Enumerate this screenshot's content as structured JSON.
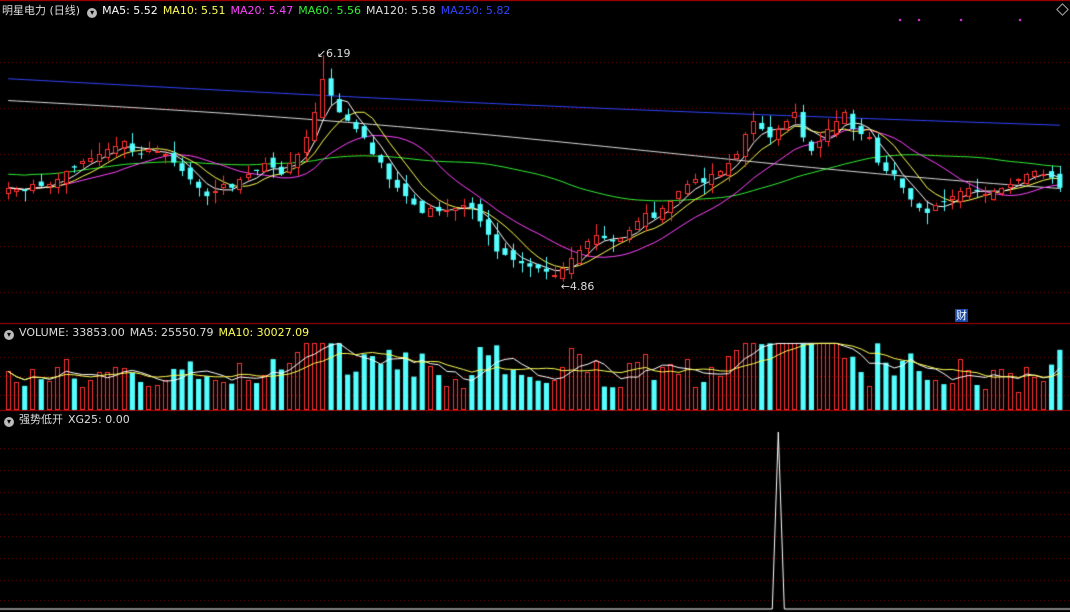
{
  "title": "明星电力 (日线)",
  "main_panel": {
    "ma_labels": [
      {
        "text": "MA5: 5.52",
        "color": "#ffffff"
      },
      {
        "text": "MA10: 5.51",
        "color": "#ffff55"
      },
      {
        "text": "MA20: 5.47",
        "color": "#ff44ff"
      },
      {
        "text": "MA60: 5.56",
        "color": "#33ee33"
      },
      {
        "text": "MA120: 5.58",
        "color": "#dddddd"
      },
      {
        "text": "MA250: 5.82",
        "color": "#3344ff"
      }
    ],
    "high_label": "6.19",
    "low_label": "4.86",
    "finance_badge": "财"
  },
  "volume_panel": {
    "labels": [
      {
        "text": "VOLUME: 33853.00",
        "color": "#dddddd"
      },
      {
        "text": "MA5: 25550.79",
        "color": "#dddddd"
      },
      {
        "text": "MA10: 30027.09",
        "color": "#ffff55"
      }
    ]
  },
  "indicator_panel": {
    "name": "强势低开",
    "labels": [
      {
        "text": "XG25: 0.00",
        "color": "#dddddd"
      }
    ]
  },
  "colors": {
    "up": "#ff3030",
    "down": "#54ffff",
    "grid": "#7a0000",
    "border": "#b00000"
  },
  "chart_data": {
    "type": "candlestick",
    "price_range": [
      4.86,
      6.19
    ],
    "high": 6.19,
    "low": 4.86,
    "close_levels": [
      5.4,
      5.39,
      5.38,
      5.42,
      5.41,
      5.42,
      5.45,
      5.5,
      5.52,
      5.56,
      5.58,
      5.6,
      5.63,
      5.65,
      5.68,
      5.62,
      5.6,
      5.63,
      5.62,
      5.6,
      5.55,
      5.5,
      5.45,
      5.4,
      5.35,
      5.38,
      5.42,
      5.4,
      5.45,
      5.48,
      5.5,
      5.55,
      5.52,
      5.48,
      5.55,
      5.6,
      5.7,
      5.85,
      6.05,
      5.95,
      5.85,
      5.8,
      5.75,
      5.7,
      5.6,
      5.55,
      5.45,
      5.4,
      5.35,
      5.3,
      5.25,
      5.28,
      5.26,
      5.27,
      5.28,
      5.3,
      5.28,
      5.2,
      5.12,
      5.02,
      5.0,
      4.97,
      4.95,
      4.93,
      4.92,
      4.9,
      4.88,
      4.92,
      4.98,
      5.03,
      5.08,
      5.12,
      5.1,
      5.08,
      5.1,
      5.15,
      5.2,
      5.25,
      5.22,
      5.28,
      5.32,
      5.38,
      5.42,
      5.45,
      5.43,
      5.48,
      5.5,
      5.55,
      5.6,
      5.72,
      5.8,
      5.75,
      5.7,
      5.75,
      5.8,
      5.85,
      5.7,
      5.62,
      5.68,
      5.75,
      5.8,
      5.85,
      5.75,
      5.72,
      5.7,
      5.55,
      5.5,
      5.48,
      5.4,
      5.33,
      5.28,
      5.25,
      5.3,
      5.32,
      5.35,
      5.38,
      5.4,
      5.38,
      5.36,
      5.38,
      5.4,
      5.42,
      5.45,
      5.48,
      5.5,
      5.48,
      5.46,
      5.4
    ],
    "ma_values_last": {
      "MA5": 5.52,
      "MA10": 5.51,
      "MA20": 5.47,
      "MA60": 5.56,
      "MA120": 5.58,
      "MA250": 5.82
    },
    "volume": {
      "last": 33853.0,
      "ma5": 25550.79,
      "ma10": 30027.09
    },
    "xg25": {
      "last": 0.0,
      "spike_at_index": 93,
      "spike_value": 1
    }
  }
}
